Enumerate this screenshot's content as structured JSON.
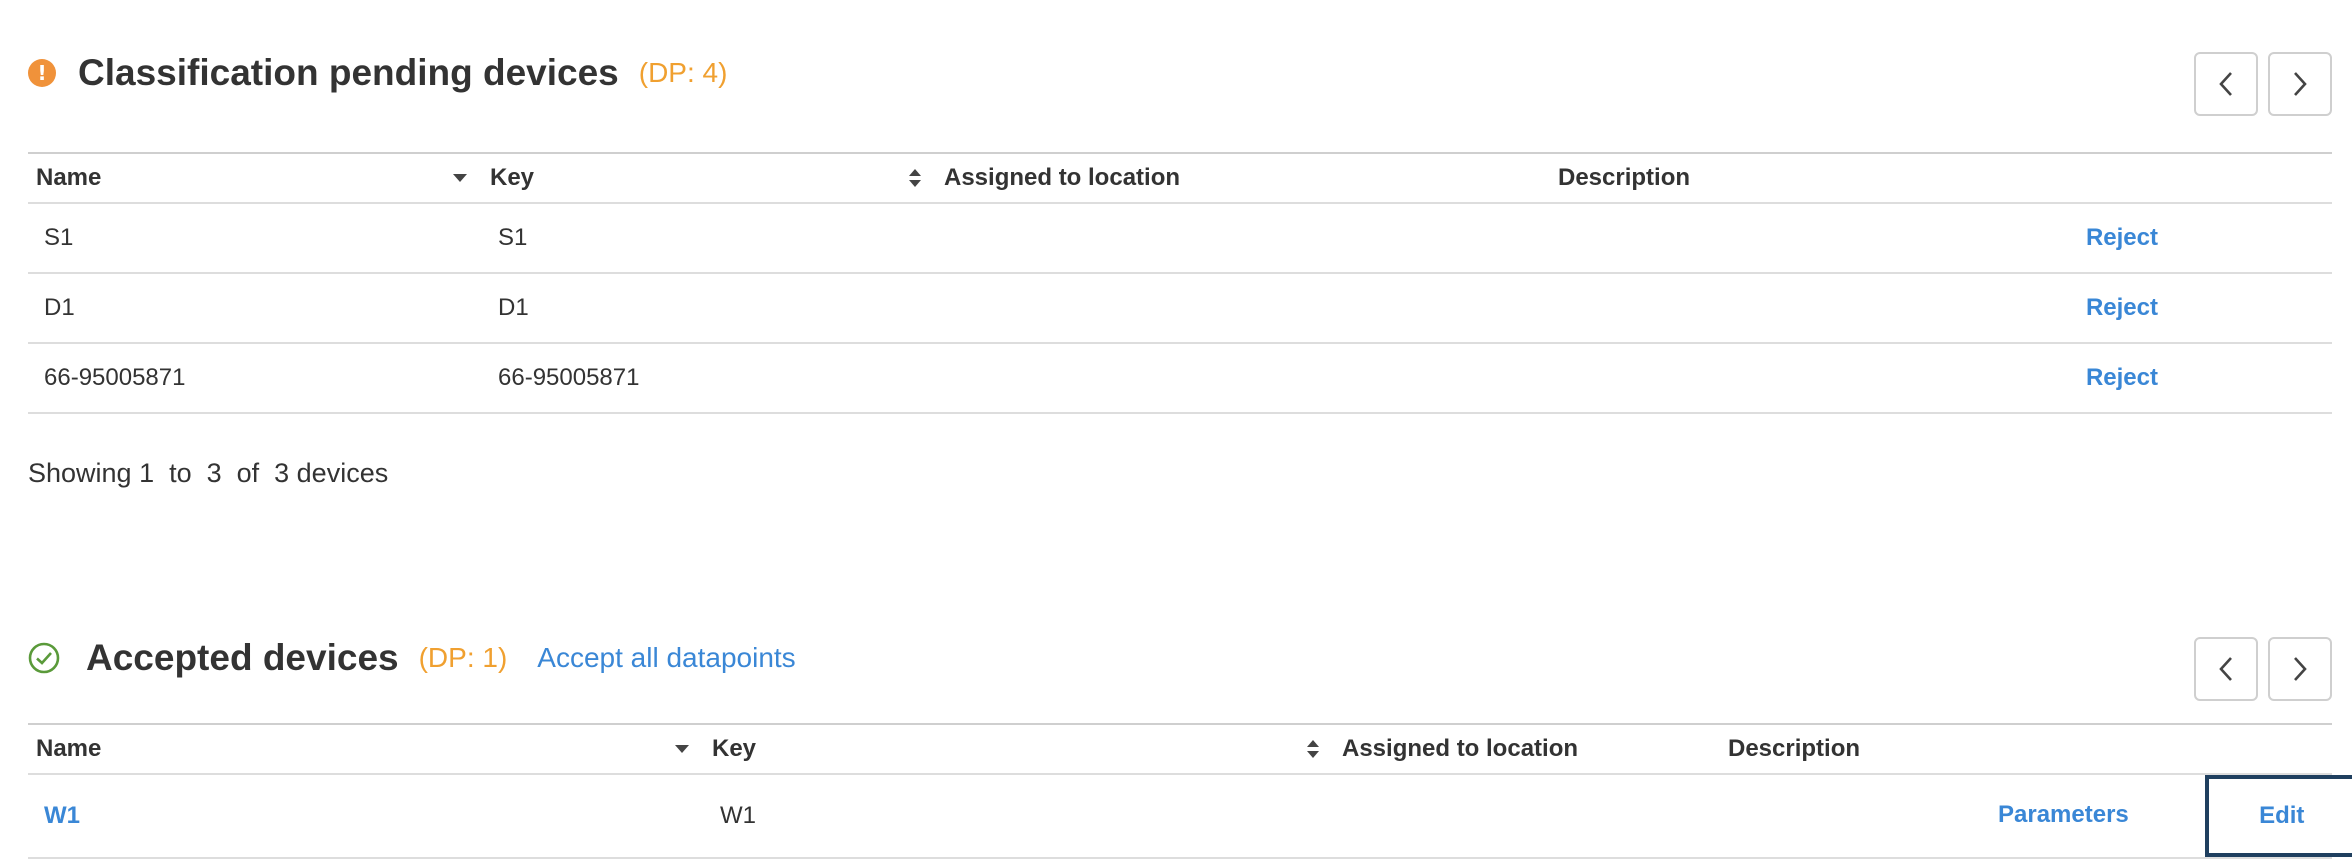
{
  "pending": {
    "title": "Classification pending devices",
    "dp": "(DP: 4)",
    "columns": {
      "name": "Name",
      "key": "Key",
      "location": "Assigned to location",
      "description": "Description"
    },
    "rows": [
      {
        "name": "S1",
        "key": "S1",
        "action": "Reject"
      },
      {
        "name": "D1",
        "key": "D1",
        "action": "Reject"
      },
      {
        "name": "66-95005871",
        "key": "66-95005871",
        "action": "Reject"
      }
    ],
    "footer": "Showing 1  to  3  of  3 devices"
  },
  "accepted": {
    "title": "Accepted devices",
    "dp": "(DP: 1)",
    "accept_all": "Accept all datapoints",
    "columns": {
      "name": "Name",
      "key": "Key",
      "location": "Assigned to location",
      "description": "Description"
    },
    "rows": [
      {
        "name": "W1",
        "key": "W1",
        "parameters": "Parameters",
        "edit": "Edit"
      }
    ]
  },
  "colors": {
    "accent": "#3a87d6",
    "warning": "#f0923a",
    "dp": "#f0a030",
    "success": "#5a9a3a"
  },
  "icons": {
    "pending": "exclamation-circle-icon",
    "accepted": "check-circle-icon"
  }
}
